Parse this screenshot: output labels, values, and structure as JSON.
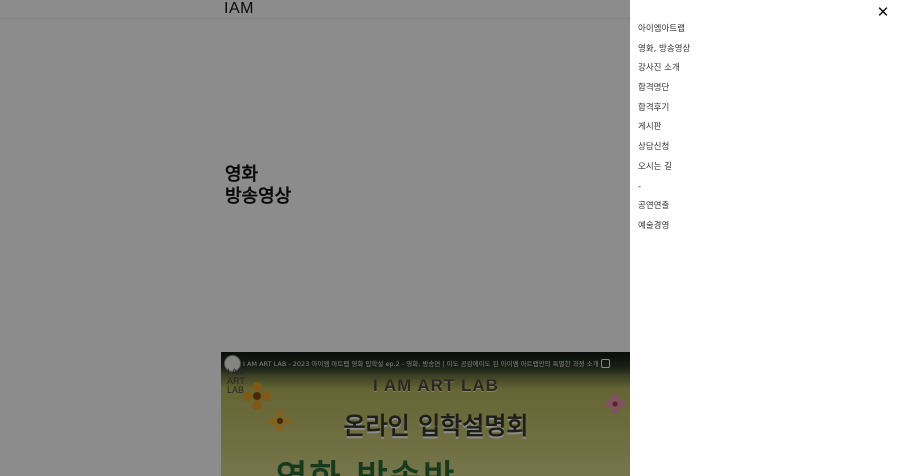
{
  "header": {
    "logo": "IAM"
  },
  "hero": {
    "title_line1": "영화",
    "title_line2": "방송영상"
  },
  "video": {
    "channel_mark": "I AM\nART\nLAB",
    "caption": "I AM ART LAB - 2023 아이엠 아트랩 영화 입학설 ep.2 - 영화, 방송연 | 이도 공감에이도 된 아이엠 아트랩만의 특별한 과정 소개",
    "banner": "I AM ART LAB",
    "subtitle": "온라인 입학설명회",
    "big_text": "영화  방송반"
  },
  "menu": {
    "close_label": "✕",
    "items": [
      {
        "label": "아이엠아트랩"
      },
      {
        "label": "영화, 방송영상"
      },
      {
        "label": "강사진 소개"
      },
      {
        "label": "합격명단"
      },
      {
        "label": "합격후기"
      },
      {
        "label": "게시판"
      },
      {
        "label": "상담신청"
      },
      {
        "label": "오시는 길"
      },
      {
        "label": "-"
      },
      {
        "label": "공연연출"
      },
      {
        "label": "예술경영"
      }
    ]
  },
  "colors": {
    "overlay": "#000000",
    "menu_background": "#ffffff",
    "banner_green": "#2a6a35"
  }
}
